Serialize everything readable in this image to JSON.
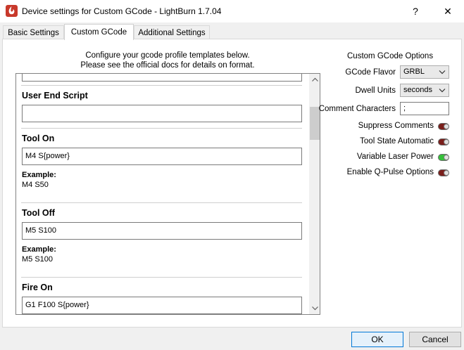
{
  "window": {
    "title": "Device settings for Custom GCode - LightBurn 1.7.04",
    "help_glyph": "?",
    "close_glyph": "✕",
    "app_icon": "lightburn-logo-icon"
  },
  "tabs": [
    {
      "label": "Basic Settings",
      "active": false
    },
    {
      "label": "Custom GCode",
      "active": true
    },
    {
      "label": "Additional Settings",
      "active": false
    }
  ],
  "intro": {
    "line1": "Configure your gcode profile templates below.",
    "line2": "Please see the official docs for details on format."
  },
  "sections": {
    "user_end": {
      "title": "User End Script",
      "value": ""
    },
    "tool_on": {
      "title": "Tool On",
      "value": "M4 S{power}",
      "example_label": "Example:",
      "example_value": "M4 S50"
    },
    "tool_off": {
      "title": "Tool Off",
      "value": "M5 S100",
      "example_label": "Example:",
      "example_value": "M5 S100"
    },
    "fire_on": {
      "title": "Fire On",
      "value": "G1 F100 S{power}"
    }
  },
  "options": {
    "heading": "Custom GCode Options",
    "gcode_flavor": {
      "label": "GCode Flavor",
      "value": "GRBL"
    },
    "dwell_units": {
      "label": "Dwell Units",
      "value": "seconds"
    },
    "comment_chars": {
      "label": "Comment Characters",
      "value": ";"
    },
    "suppress_comments": {
      "label": "Suppress Comments",
      "enabled": false
    },
    "tool_state_auto": {
      "label": "Tool State Automatic",
      "enabled": false
    },
    "variable_laser_power": {
      "label": "Variable Laser Power",
      "enabled": true
    },
    "q_pulse": {
      "label": "Enable Q-Pulse Options",
      "enabled": false
    }
  },
  "buttons": {
    "ok": "OK",
    "cancel": "Cancel"
  },
  "colors": {
    "toggle_off": "#7a1e1a",
    "toggle_on": "#35c03a",
    "accent": "#0078d7"
  }
}
